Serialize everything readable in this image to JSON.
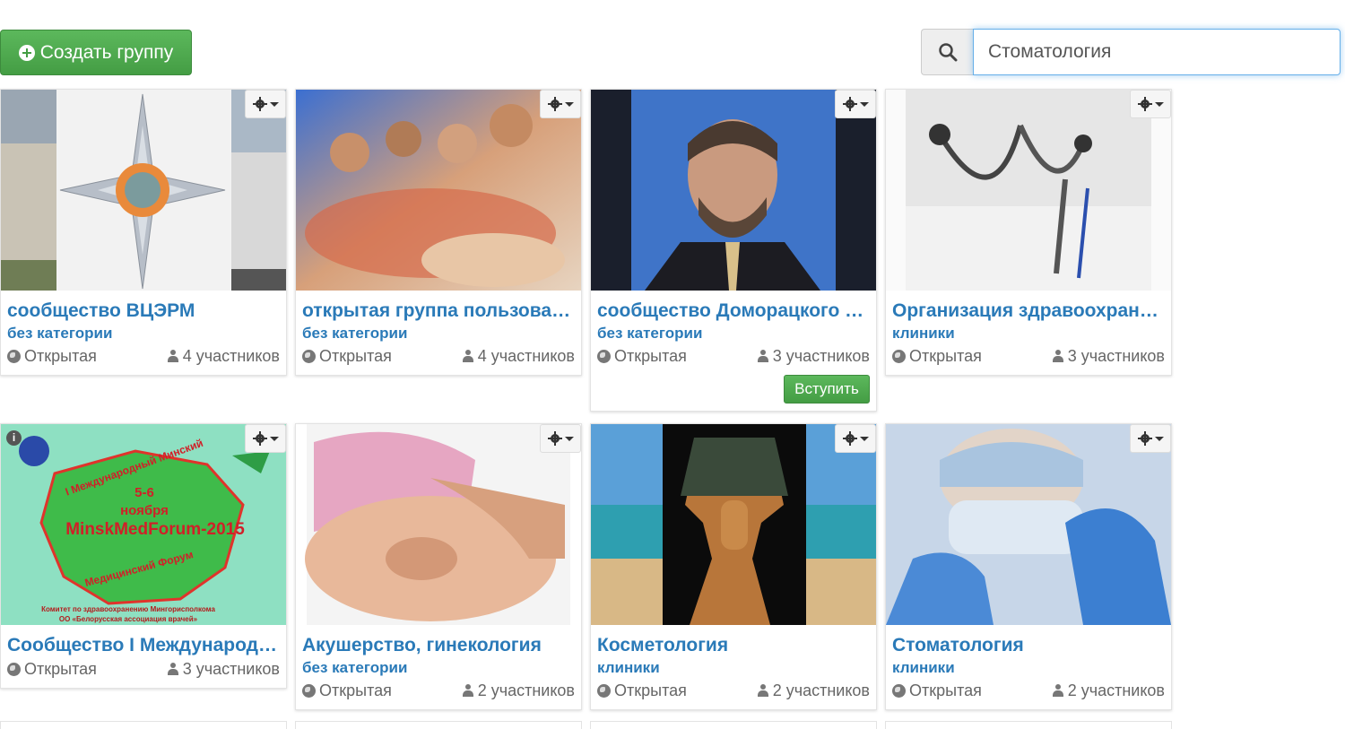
{
  "toolbar": {
    "create_label": "Создать группу",
    "search_value": "Стоматология",
    "search_icon": "search-icon"
  },
  "groups": [
    {
      "title": "сообщество ВЦЭРМ",
      "category": "без категории",
      "access": "Открытая",
      "members": "4 участников"
    },
    {
      "title": "открытая группа пользова…",
      "category": "без категории",
      "access": "Открытая",
      "members": "4 участников"
    },
    {
      "title": "сообщество Доморацкого …",
      "category": "без категории",
      "access": "Открытая",
      "members": "3 участников",
      "join_label": "Вступить"
    },
    {
      "title": "Организация здравоохран…",
      "category": "клиники",
      "access": "Открытая",
      "members": "3 участников"
    },
    {
      "title": "Сообщество I Международ…",
      "category": "",
      "access": "Открытая",
      "members": "3 участников",
      "image_text": {
        "line1": "5-6",
        "line2": "ноября",
        "line3": "MinskMedForum-2015",
        "arc_top": "I Международный Минский",
        "arc_bottom": "Медицинский Форум",
        "footer1": "Комитет по здравоохранению Мингорисполкома",
        "footer2": "ОО «Белорусская ассоциация врачей»"
      }
    },
    {
      "title": "Акушерство, гинекология",
      "category": "без категории",
      "access": "Открытая",
      "members": "2 участников"
    },
    {
      "title": "Косметология",
      "category": "клиники",
      "access": "Открытая",
      "members": "2 участников"
    },
    {
      "title": "Стоматология",
      "category": "клиники",
      "access": "Открытая",
      "members": "2 участников"
    }
  ],
  "colors": {
    "accent": "#2a7ab8",
    "success": "#5cb85c"
  }
}
